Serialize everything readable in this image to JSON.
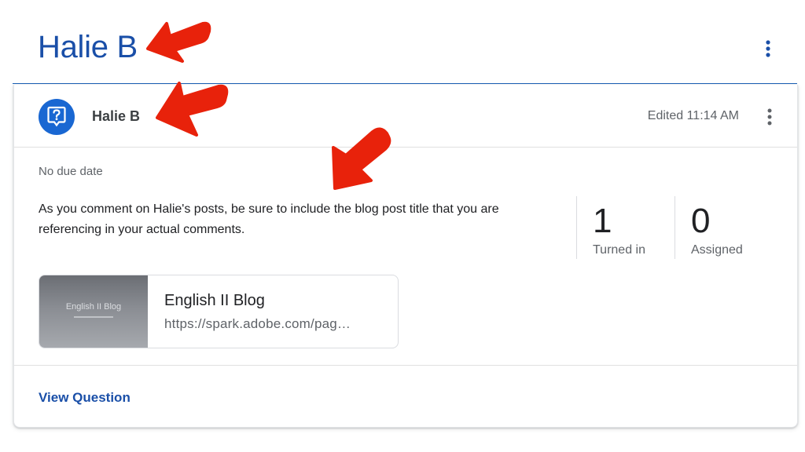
{
  "page": {
    "title": "Halie B"
  },
  "post": {
    "author": "Halie B",
    "edited": "Edited 11:14 AM",
    "due": "No due date",
    "description": "As you comment on Halie's posts, be sure to include the blog post title that you are referencing in your actual comments.",
    "stats": [
      {
        "value": "1",
        "label": "Turned in"
      },
      {
        "value": "0",
        "label": "Assigned"
      }
    ],
    "attachment": {
      "title": "English II Blog",
      "url": "https://spark.adobe.com/pag…",
      "thumbnail_text": "English II Blog"
    },
    "action_label": "View Question"
  },
  "icons": {
    "question": "question-bubble-icon",
    "more": "more-vert-icon",
    "annotation": "red-arrow-annotation"
  },
  "colors": {
    "title_blue": "#1a4fa8",
    "avatar_blue": "#1967d2",
    "annotation_red": "#e8220b"
  }
}
